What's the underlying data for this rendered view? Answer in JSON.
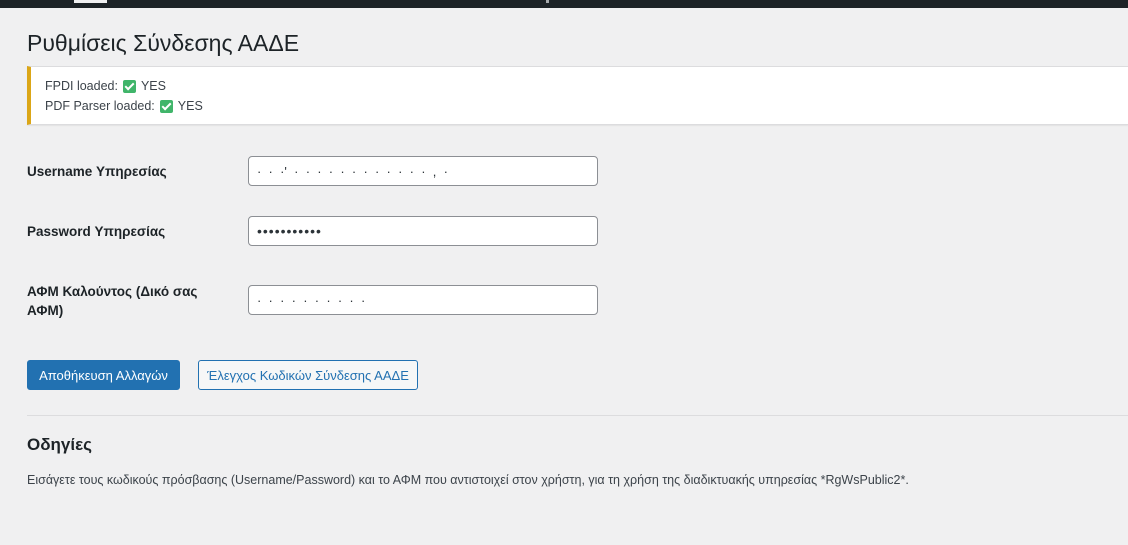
{
  "page": {
    "title": "Ρυθμίσεις Σύνδεσης ΑΑΔΕ"
  },
  "notice": {
    "fpdi_label": "FPDI loaded:",
    "fpdi_value": "YES",
    "parser_label": "PDF Parser loaded:",
    "parser_value": "YES",
    "border_color": "#dba617",
    "check_color": "#40b56a"
  },
  "form": {
    "username": {
      "label": "Username Υπηρεσίας",
      "value": "·  ·  ·'  ·  ·  ·  ·  ·  ·  ·  ·  ·  ·  ·  ·  ,  ·"
    },
    "password": {
      "label": "Password Υπηρεσίας",
      "value": "•••••••••••"
    },
    "afm": {
      "label": "ΑΦΜ Καλούντος (Δικό σας ΑΦΜ)",
      "value": "·  ·  ·  ·  ·  ·  ·  ·  ·  ·"
    }
  },
  "buttons": {
    "save": "Αποθήκευση Αλλαγών",
    "check": "Έλεγχος Κωδικών Σύνδεσης ΑΑΔΕ",
    "primary_color": "#2271b1"
  },
  "instructions": {
    "heading": "Οδηγίες",
    "text": "Εισάγετε τους κωδικούς πρόσβασης (Username/Password) και το ΑΦΜ που αντιστοιχεί στον χρήστη, για τη χρήση της διαδικτυακής υπηρεσίας *RgWsPublic2*."
  }
}
